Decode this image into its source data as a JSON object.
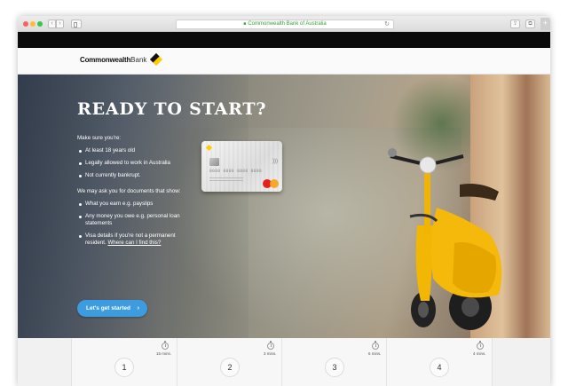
{
  "browser": {
    "url": "Commonwealth Bank of Australia",
    "nav_back": "‹",
    "nav_forward": "›",
    "reload": "↻",
    "share": "⇪",
    "tabs": "⧉",
    "new_tab": "+"
  },
  "header": {
    "logo_bold": "Commonwealth",
    "logo_light": "Bank"
  },
  "hero": {
    "title": "READY TO START?",
    "intro": "Make sure you're:",
    "requirements": [
      "At least 18 years old",
      "Legally allowed to work in Australia",
      "Not currently bankrupt."
    ],
    "documents_intro": "We may ask you for documents that show:",
    "documents": [
      "What you earn e.g. payslips",
      "Any money you owe e.g. personal loan statements"
    ],
    "visa_text": "Visa details if you're not a permanent resident.",
    "visa_link": "Where can I find this?",
    "cta_label": "Let's get started",
    "cta_chevron": "›"
  },
  "card": {
    "number": "0000 0000 0000 0000",
    "contactless": ")))"
  },
  "steps": [
    {
      "number": "1",
      "time": "15 mins."
    },
    {
      "number": "2",
      "time": "3 mins."
    },
    {
      "number": "3",
      "time": "6 mins."
    },
    {
      "number": "4",
      "time": "4 mins."
    }
  ]
}
